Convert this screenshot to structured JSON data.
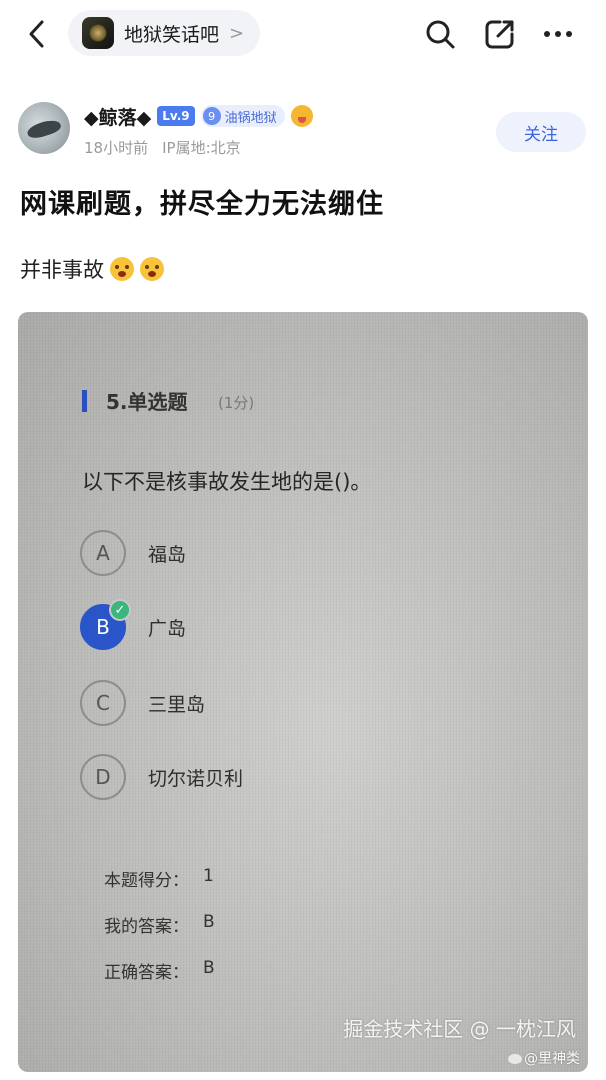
{
  "topbar": {
    "forum_name": "地狱笑话吧",
    "chevron": ">"
  },
  "author": {
    "name": "◆鲸落◆",
    "level_badge": "Lv.9",
    "fan_level": "9",
    "fan_title": "油锅地狱",
    "time": "18小时前",
    "ip_location": "IP属地:北京",
    "follow_label": "关注"
  },
  "post": {
    "title": "网课刷题，拼尽全力无法绷住",
    "body": "并非事故"
  },
  "quiz": {
    "question_title": "5.单选题",
    "score_hint": "(1分)",
    "stem": "以下不是核事故发生地的是()。",
    "options": [
      {
        "letter": "A",
        "text": "福岛"
      },
      {
        "letter": "B",
        "text": "广岛"
      },
      {
        "letter": "C",
        "text": "三里岛"
      },
      {
        "letter": "D",
        "text": "切尔诺贝利"
      }
    ],
    "selected": "B",
    "check_mark": "✓",
    "result": [
      {
        "label": "本题得分：",
        "value": "1"
      },
      {
        "label": "我的答案：",
        "value": "B"
      },
      {
        "label": "正确答案：",
        "value": "B"
      }
    ]
  },
  "watermark": {
    "line1": "掘金技术社区 @ 一枕江风",
    "line2": "@里神类"
  },
  "colors": {
    "accent": "#3d64e0",
    "selected_option": "#2a55c8",
    "check_green": "#3bb67d"
  }
}
